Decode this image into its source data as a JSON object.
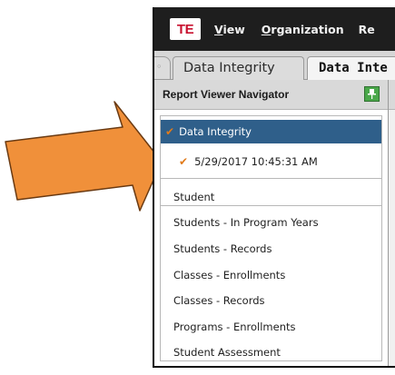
{
  "menu": {
    "logo": "TE",
    "items": [
      "View",
      "Organization",
      "Re"
    ],
    "underlined": [
      "V",
      "O",
      ""
    ]
  },
  "tabs": {
    "inactive_label": "Data Integrity",
    "active_label": "Data Inte"
  },
  "navigator": {
    "title": "Report Viewer Navigator",
    "pin_icon": "pin-icon",
    "tree": {
      "selected_label": "Data Integrity",
      "child_label": "5/29/2017 10:45:31 AM"
    },
    "reports": [
      "Student",
      "Students - In Program Years",
      "Students - Records",
      "Classes - Enrollments",
      "Classes - Records",
      "Programs - Enrollments",
      "Student Assessment"
    ]
  },
  "colors": {
    "arrow": "#f0903a",
    "selection": "#2f5f8a",
    "checkmark": "#e07a1a",
    "pin": "#4aa84a",
    "logo_text": "#c8102e"
  }
}
